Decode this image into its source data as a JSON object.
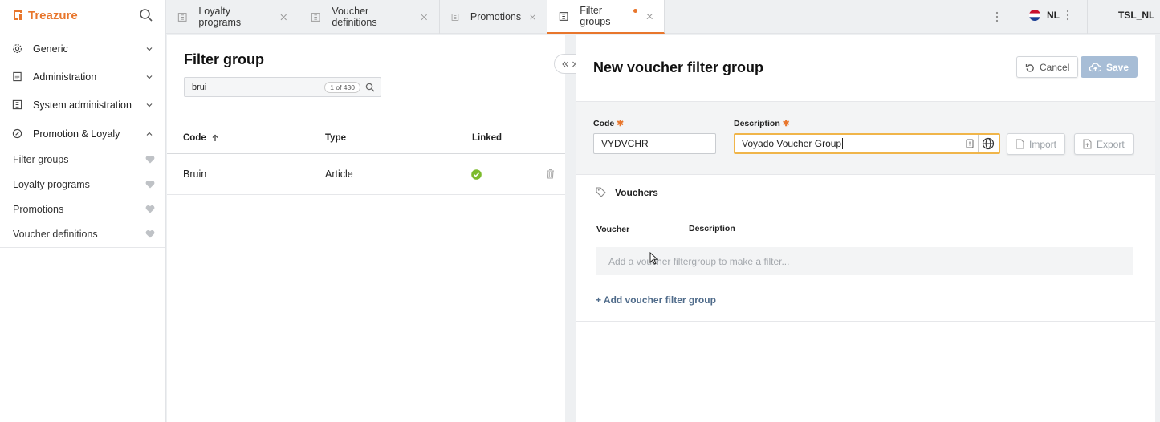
{
  "app": {
    "brand": "Treazure"
  },
  "sidebar": {
    "items": [
      {
        "label": "Generic",
        "icon": "gear-icon",
        "chevron": "down"
      },
      {
        "label": "Administration",
        "icon": "document-icon",
        "chevron": "down"
      },
      {
        "label": "System administration",
        "icon": "system-icon",
        "chevron": "down"
      },
      {
        "label": "Promotion & Loyaly",
        "icon": "promotion-icon",
        "chevron": "up"
      }
    ],
    "subitems": [
      {
        "label": "Filter groups"
      },
      {
        "label": "Loyalty programs"
      },
      {
        "label": "Promotions"
      },
      {
        "label": "Voucher definitions"
      }
    ]
  },
  "tabs": [
    {
      "label": "Loyalty programs",
      "active": false
    },
    {
      "label": "Voucher definitions",
      "active": false
    },
    {
      "label": "Promotions",
      "active": false
    },
    {
      "label": "Filter groups",
      "active": true,
      "unsaved": true
    }
  ],
  "header": {
    "language": "NL",
    "tenant": "TSL_NL"
  },
  "list": {
    "title": "Filter group",
    "search_value": "brui",
    "result_count": "1 of 430",
    "columns": {
      "code": "Code",
      "type": "Type",
      "linked": "Linked"
    },
    "rows": [
      {
        "code": "Bruin",
        "type": "Article",
        "linked": true
      }
    ]
  },
  "form": {
    "title": "New voucher filter group",
    "cancel_label": "Cancel",
    "save_label": "Save",
    "code_label": "Code",
    "code_value": "VYDVCHR",
    "description_label": "Description",
    "description_value": "Voyado Voucher Group",
    "import_label": "Import",
    "export_label": "Export",
    "vouchers_section": "Vouchers",
    "voucher_col": "Voucher",
    "description_col": "Description",
    "empty_placeholder": "Add a voucher filtergroup to make a filter...",
    "add_label": "+ Add voucher filter group"
  },
  "colors": {
    "accent": "#e8762c",
    "linked_green": "#7cbb2c",
    "save_disabled": "#a7bdd6"
  }
}
